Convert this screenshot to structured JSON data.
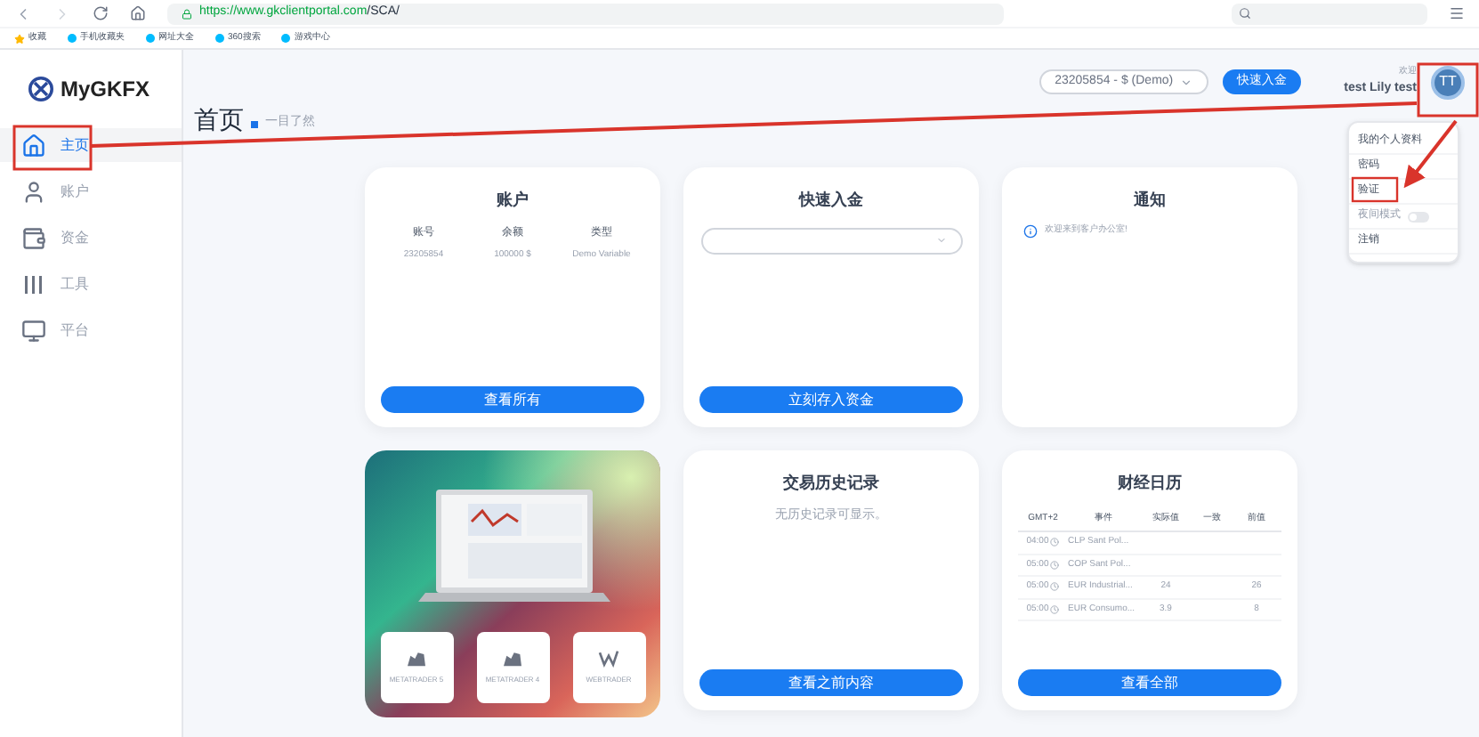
{
  "browser": {
    "url_domain": "https://www.gkclientportal.com",
    "url_path": "/SCA/",
    "bookmarks": [
      {
        "label": "收藏"
      },
      {
        "label": "手机收藏夹"
      },
      {
        "label": "网址大全"
      },
      {
        "label": "360搜索"
      },
      {
        "label": "游戏中心"
      }
    ]
  },
  "sidebar": {
    "logo": "MyGKFX",
    "items": [
      {
        "label": "主页",
        "selected": true,
        "kind": "home"
      },
      {
        "label": "账户",
        "selected": false,
        "kind": "user"
      },
      {
        "label": "资金",
        "selected": false,
        "kind": "wallet"
      },
      {
        "label": "工具",
        "selected": false,
        "kind": "tools"
      },
      {
        "label": "平台",
        "selected": false,
        "kind": "platform"
      }
    ]
  },
  "header": {
    "title": "首页",
    "subtitle": "一目了然"
  },
  "topbar": {
    "account_select": "23205854 - $ (Demo)",
    "deposit_button": "快速入金",
    "welcome": "欢迎",
    "user": "test Lily test",
    "avatar": "TT"
  },
  "user_menu": [
    {
      "label": "我的个人资料",
      "kind": "item",
      "disabled": false
    },
    {
      "label": "密码",
      "kind": "item",
      "disabled": false
    },
    {
      "label": "验证",
      "kind": "item",
      "disabled": false
    },
    {
      "label": "夜间模式",
      "kind": "toggle",
      "disabled": true,
      "on": false
    },
    {
      "label": "注销",
      "kind": "item",
      "disabled": false
    }
  ],
  "account_card": {
    "title": "账户",
    "columns": [
      "账号",
      "余额",
      "类型"
    ],
    "values": [
      "23205854",
      "100000 $",
      "Demo Variable"
    ],
    "button": "查看所有"
  },
  "deposit_card": {
    "title": "快速入金",
    "button": "立刻存入资金"
  },
  "notice_card": {
    "title": "通知",
    "message": "欢迎来到客户办公室!"
  },
  "platforms": [
    {
      "label": "METATRADER 5",
      "kind": "mt"
    },
    {
      "label": "METATRADER 4",
      "kind": "mt"
    },
    {
      "label": "WEBTRADER",
      "kind": "web"
    }
  ],
  "history_card": {
    "title": "交易历史记录",
    "message": "无历史记录可显示。",
    "button": "查看之前内容"
  },
  "calendar_card": {
    "title": "财经日历",
    "columns": [
      "GMT+2",
      "事件",
      "实际值",
      "一致",
      "前值"
    ],
    "rows": [
      {
        "time": "04:00",
        "event": "CLP Sant Pol...",
        "actual": "",
        "consensus": "",
        "previous": ""
      },
      {
        "time": "05:00",
        "event": "COP Sant Pol...",
        "actual": "",
        "consensus": "",
        "previous": ""
      },
      {
        "time": "05:00",
        "event": "EUR Industrial...",
        "actual": "24",
        "consensus": "",
        "previous": "26"
      },
      {
        "time": "05:00",
        "event": "EUR Consumo...",
        "actual": "3.9",
        "consensus": "",
        "previous": "8"
      }
    ],
    "button": "查看全部"
  }
}
